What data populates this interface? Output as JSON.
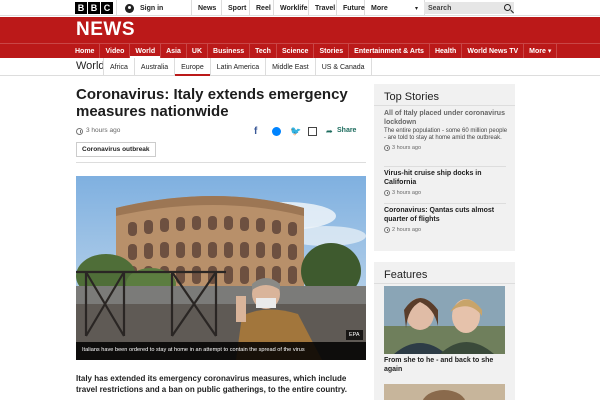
{
  "bbc_logo": [
    "B",
    "B",
    "C"
  ],
  "topbar": {
    "signin_label": "Sign in",
    "nav": [
      "News",
      "Sport",
      "Reel",
      "Worklife",
      "Travel",
      "Future",
      "More"
    ],
    "search_placeholder": "Search"
  },
  "masthead": {
    "brand": "NEWS",
    "nav": [
      "Home",
      "Video",
      "World",
      "Asia",
      "UK",
      "Business",
      "Tech",
      "Science",
      "Stories",
      "Entertainment & Arts",
      "Health",
      "World News TV",
      "More ▾"
    ],
    "active_item": "World"
  },
  "subnav": {
    "section": "World",
    "items": [
      "Africa",
      "Australia",
      "Europe",
      "Latin America",
      "Middle East",
      "US & Canada"
    ],
    "active_item": "Europe"
  },
  "article": {
    "headline": "Coronavirus: Italy extends emergency measures nationwide",
    "timestamp": "3 hours ago",
    "share_label": "Share",
    "tag": "Coronavirus outbreak",
    "image_caption": "Italians have been ordered to stay at home in an attempt to contain the spread of the virus",
    "image_credit": "EPA",
    "lede": "Italy has extended its emergency coronavirus measures, which include travel restrictions and a ban on public gatherings, to the entire country."
  },
  "top_stories": {
    "heading": "Top Stories",
    "items": [
      {
        "title": "All of Italy placed under coronavirus lockdown",
        "summary": "The entire population - some 60 million people - are told to stay at home amid the outbreak.",
        "time": "3 hours ago"
      },
      {
        "title": "Virus-hit cruise ship docks in California",
        "time": "3 hours ago"
      },
      {
        "title": "Coronavirus: Qantas cuts almost quarter of flights",
        "time": "2 hours ago"
      }
    ]
  },
  "features": {
    "heading": "Features",
    "items": [
      {
        "title": "From she to he - and back to she again"
      }
    ]
  },
  "colors": {
    "bbc_red": "#bb1919",
    "share_green": "#1c6b5d",
    "panel_grey": "#f1f1f1"
  }
}
